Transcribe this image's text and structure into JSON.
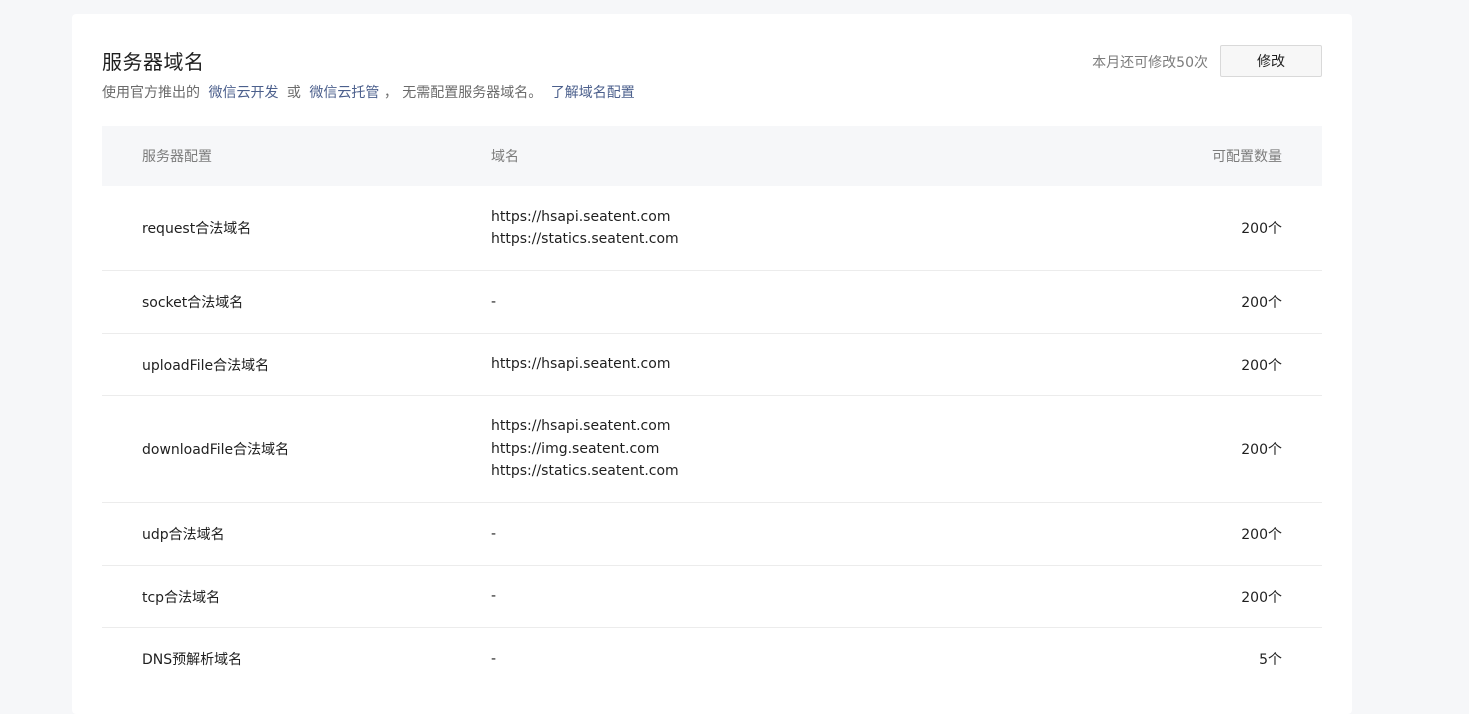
{
  "header": {
    "title": "服务器域名",
    "subtitle_prefix": "使用官方推出的",
    "link_cloud_dev": "微信云开发",
    "or_text": "或",
    "link_cloud_hosting": "微信云托管",
    "subtitle_suffix": "， 无需配置服务器域名。",
    "link_learn_more": "了解域名配置",
    "remaining_text": "本月还可修改50次",
    "edit_button": "修改"
  },
  "table": {
    "columns": [
      "服务器配置",
      "域名",
      "可配置数量"
    ],
    "rows": [
      {
        "name": "request合法域名",
        "domains": [
          "https://hsapi.seatent.com",
          "https://statics.seatent.com"
        ],
        "quota": "200个"
      },
      {
        "name": "socket合法域名",
        "domains": [
          "-"
        ],
        "quota": "200个"
      },
      {
        "name": "uploadFile合法域名",
        "domains": [
          "https://hsapi.seatent.com"
        ],
        "quota": "200个"
      },
      {
        "name": "downloadFile合法域名",
        "domains": [
          "https://hsapi.seatent.com",
          "https://img.seatent.com",
          "https://statics.seatent.com"
        ],
        "quota": "200个"
      },
      {
        "name": "udp合法域名",
        "domains": [
          "-"
        ],
        "quota": "200个"
      },
      {
        "name": "tcp合法域名",
        "domains": [
          "-"
        ],
        "quota": "200个"
      },
      {
        "name": "DNS预解析域名",
        "domains": [
          "-"
        ],
        "quota": "5个"
      }
    ]
  },
  "colors": {
    "link": "#4b5f8c",
    "header_bg": "#f6f7f9",
    "muted_text": "#7c7c7c"
  }
}
